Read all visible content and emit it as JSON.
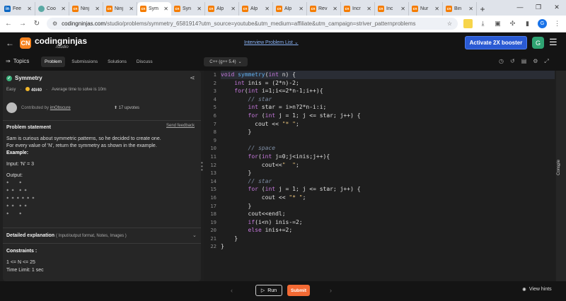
{
  "browser": {
    "tabs": [
      {
        "label": "Fee",
        "icon": "linkedin-icon",
        "kind": "li",
        "active": false
      },
      {
        "label": "Coo",
        "icon": "globe-icon",
        "kind": "co",
        "active": false
      },
      {
        "label": "Ninj",
        "icon": "codingninjas-icon",
        "kind": "cn",
        "active": false
      },
      {
        "label": "Ninj",
        "icon": "codingninjas-icon",
        "kind": "cn",
        "active": false
      },
      {
        "label": "Sym",
        "icon": "codingninjas-icon",
        "kind": "cn",
        "active": true
      },
      {
        "label": "Syn",
        "icon": "codingninjas-icon",
        "kind": "cn",
        "active": false
      },
      {
        "label": "Alp",
        "icon": "codingninjas-icon",
        "kind": "cn",
        "active": false
      },
      {
        "label": "Alp",
        "icon": "codingninjas-icon",
        "kind": "cn",
        "active": false
      },
      {
        "label": "Alp",
        "icon": "codingninjas-icon",
        "kind": "cn",
        "active": false
      },
      {
        "label": "Rev",
        "icon": "codingninjas-icon",
        "kind": "cn",
        "active": false
      },
      {
        "label": "Incr",
        "icon": "codingninjas-icon",
        "kind": "cn",
        "active": false
      },
      {
        "label": "Inc",
        "icon": "codingninjas-icon",
        "kind": "cn",
        "active": false
      },
      {
        "label": "Nur",
        "icon": "codingninjas-icon",
        "kind": "cn",
        "active": false
      },
      {
        "label": "Bin",
        "icon": "codingninjas-icon",
        "kind": "cn",
        "active": false
      }
    ],
    "url_host": "codingninjas.com",
    "url_path": "/studio/problems/symmetry_6581914?utm_source=youtube&utm_medium=affiliate&utm_campaign=striver_patternproblems",
    "profile_initial": "G"
  },
  "header": {
    "brand": "codingninjas",
    "sub": "/studio",
    "interview_list": "Interview Problem List",
    "booster": "Activate 2X booster",
    "avatar": "G"
  },
  "toolbar": {
    "topics": "Topics",
    "tabs": [
      "Problem",
      "Submissions",
      "Solutions",
      "Discuss"
    ],
    "language": "C++ (g++ 5.4)"
  },
  "problem": {
    "title": "Symmetry",
    "difficulty": "Easy",
    "score": "40/40",
    "avg_time": "Average time to solve is 10m",
    "contributed_prefix": "Contributed by",
    "contributor": "imObscure",
    "upvotes": "17 upvotes",
    "statement_heading": "Problem statement",
    "feedback": "Send feedback",
    "line1": "Sam is curious about symmetric patterns, so he decided to create one.",
    "line2": "For every value of 'N', return the symmetry as shown in the example.",
    "example_label": "Example:",
    "input": "Input: 'N' = 3",
    "output_label": "Output:",
    "output_lines": [
      "*    *",
      "* *  * *",
      "* * * * * *",
      "* *  * *",
      "*    *"
    ],
    "detailed": "Detailed explanation",
    "detailed_sub": "( Input/output format, Notes, Images )",
    "constraints_heading": "Constraints :",
    "constraint1": "1  <= N <= 25",
    "constraint2": "Time Limit: 1 sec"
  },
  "editor": {
    "line_numbers": [
      "1",
      "2",
      "3",
      "4",
      "5",
      "6",
      "7",
      "8",
      "9",
      "10",
      "11",
      "12",
      "13",
      "14",
      "15",
      "16",
      "17",
      "18",
      "19",
      "20",
      "21",
      "22"
    ]
  },
  "console_label": "Console",
  "bottom": {
    "run": "Run",
    "submit": "Submit",
    "hints": "View hints"
  },
  "colors": {
    "accent": "#f36a34",
    "booster": "#2a5ad3",
    "success": "#39b07a"
  }
}
